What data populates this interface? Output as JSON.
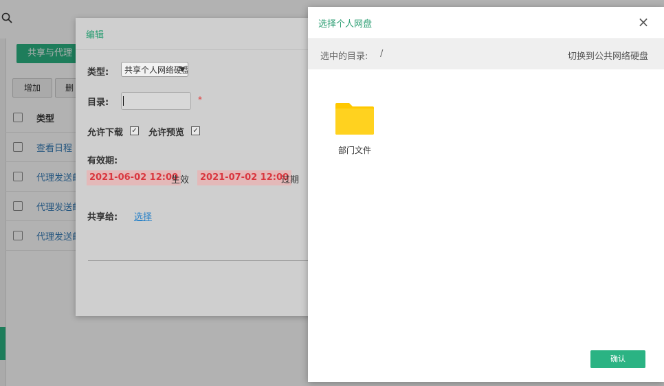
{
  "background": {
    "tab_label": "共享与代理",
    "buttons": [
      "增加",
      "删"
    ],
    "table": {
      "header": "类型",
      "rows": [
        "查看日程",
        "代理发送邮",
        "代理发送邮",
        "代理发送邮"
      ]
    }
  },
  "edit_dialog": {
    "title": "编辑",
    "type_label": "类型:",
    "type_value": "共享个人网络硬盘",
    "dir_label": "目录:",
    "dir_value": "",
    "required_mark": "*",
    "allow_download_label": "允许下载",
    "allow_preview_label": "允许预览",
    "allow_download_checked": true,
    "allow_preview_checked": true,
    "validity_label": "有效期:",
    "start_date": "2021-06-02 12:00",
    "start_suffix": "生效",
    "end_date": "2021-07-02 12:00",
    "end_suffix": "过期",
    "share_to_label": "共享给:",
    "select_link": "选择"
  },
  "picker": {
    "title": "选择个人网盘",
    "path_label": "选中的目录:",
    "path_value": "/",
    "switch_link": "切换到公共网络硬盘",
    "folders": [
      {
        "name": "部门文件",
        "icon": "folder-icon"
      }
    ],
    "confirm_label": "确认"
  },
  "colors": {
    "accent": "#2bb383",
    "title_green": "#2a9d72",
    "date_red": "#d9363e",
    "folder_yellow": "#ffd21f"
  }
}
